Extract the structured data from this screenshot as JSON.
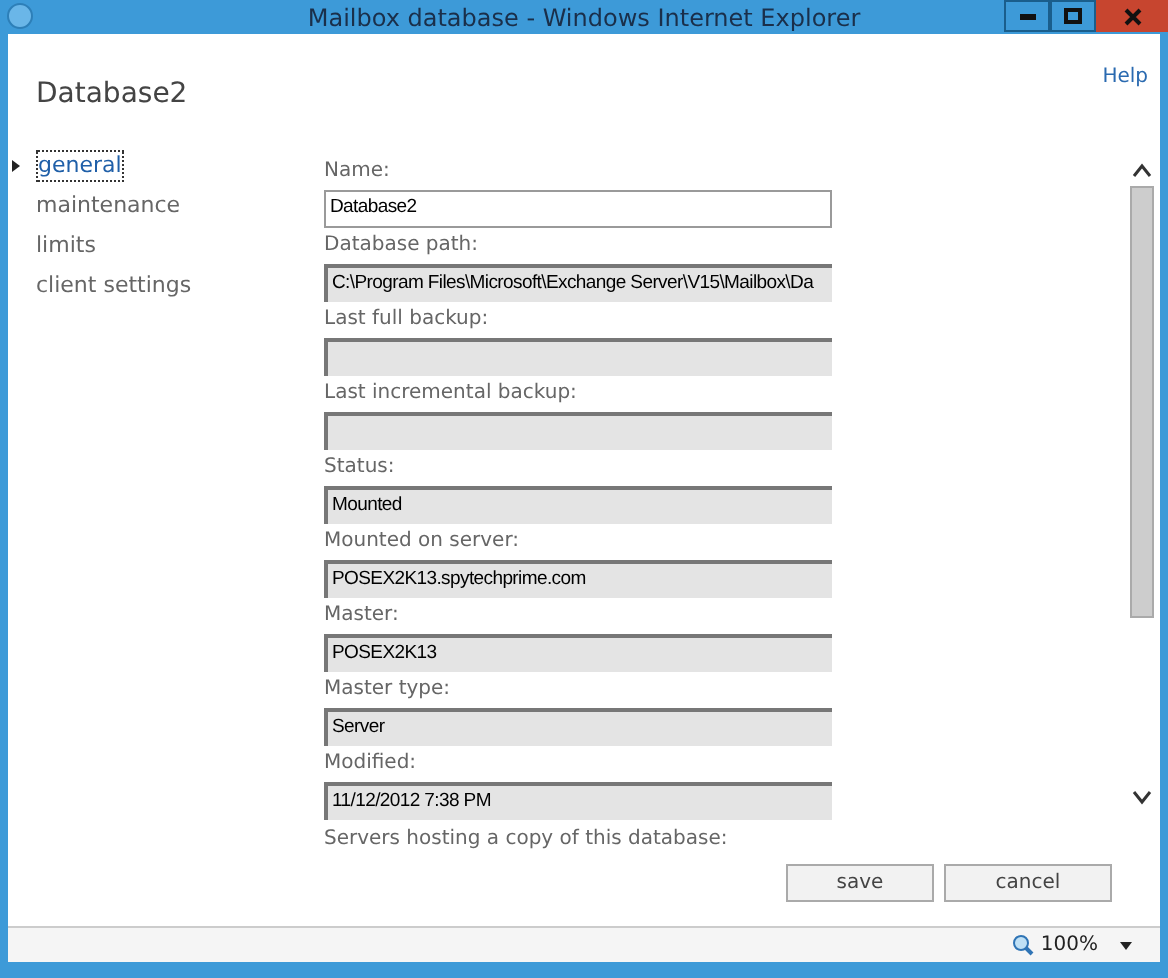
{
  "window": {
    "title": "Mailbox database - Windows Internet Explorer"
  },
  "help": "Help",
  "heading": "Database2",
  "nav": [
    {
      "label": "general",
      "selected": true
    },
    {
      "label": "maintenance",
      "selected": false
    },
    {
      "label": "limits",
      "selected": false
    },
    {
      "label": "client settings",
      "selected": false
    }
  ],
  "fields": [
    {
      "label": "Name:",
      "value": "Database2",
      "kind": "editable"
    },
    {
      "label": "Database path:",
      "value": "C:\\Program Files\\Microsoft\\Exchange Server\\V15\\Mailbox\\Da",
      "kind": "readonly"
    },
    {
      "label": "Last full backup:",
      "kind": "readonly"
    },
    {
      "label": "Last incremental backup:",
      "kind": "readonly"
    },
    {
      "label": "Status:",
      "value": "Mounted",
      "kind": "readonly"
    },
    {
      "label": "Mounted on server:",
      "value": "POSEX2K13.spytechprime.com",
      "kind": "readonly"
    },
    {
      "label": "Master:",
      "value": "POSEX2K13",
      "kind": "readonly"
    },
    {
      "label": "Master type:",
      "value": "Server",
      "kind": "readonly"
    },
    {
      "label": "Modified:",
      "value": "11/12/2012 7:38 PM",
      "kind": "readonly"
    }
  ],
  "next_label": "Servers hosting a copy of this database:",
  "buttons": [
    "save",
    "cancel"
  ],
  "status_bar": {
    "zoom": "100%"
  }
}
